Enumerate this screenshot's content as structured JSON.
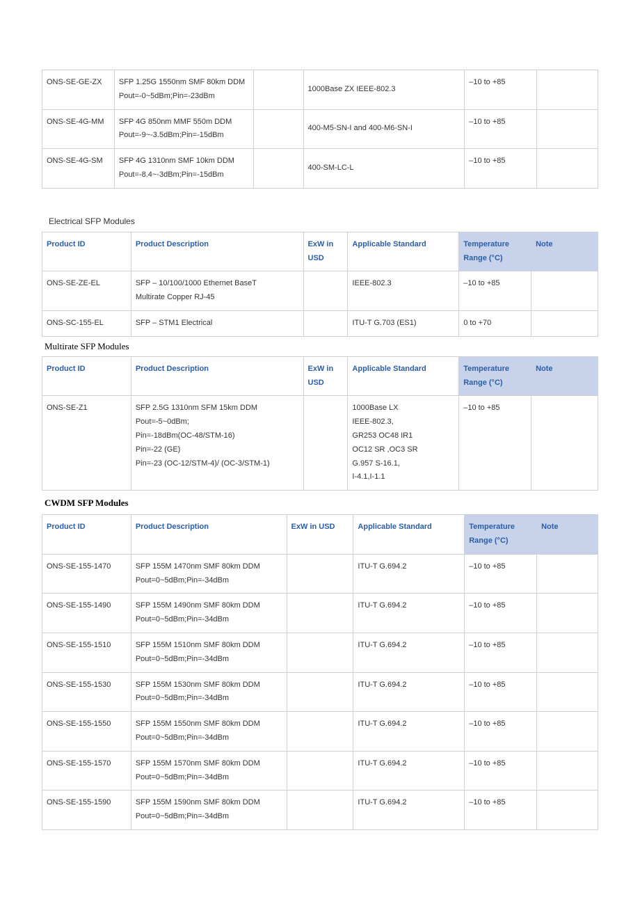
{
  "table1": {
    "rows": [
      {
        "id": "ONS-SE-GE-ZX",
        "desc": [
          "SFP 1.25G 1550nm SMF 80km DDM",
          "Pout=-0~5dBm;Pin=-23dBm"
        ],
        "exw": "",
        "std": "1000Base ZX IEEE-802.3",
        "temp": "–10 to +85",
        "note": ""
      },
      {
        "id": "ONS-SE-4G-MM",
        "desc": [
          "SFP 4G 850nm MMF 550m DDM",
          "Pout=-9~-3.5dBm;Pin=-15dBm"
        ],
        "exw": "",
        "std": "400-M5-SN-I and 400-M6-SN-I",
        "temp": "–10 to +85",
        "note": ""
      },
      {
        "id": "ONS-SE-4G-SM",
        "desc": [
          "SFP 4G 1310nm SMF 10km DDM",
          "Pout=-8.4~-3dBm;Pin=-15dBm"
        ],
        "exw": "",
        "std": "400-SM-LC-L",
        "temp": "–10 to +85",
        "note": ""
      }
    ]
  },
  "section2": {
    "title": "Electrical SFP Modules"
  },
  "table2": {
    "headers": {
      "c1": "Product ID",
      "c2": "Product Description",
      "c3": "ExW in USD",
      "c4": "Applicable Standard",
      "c5": "Temperature Range (°C)",
      "c6": "Note"
    },
    "rows": [
      {
        "id": "ONS-SE-ZE-EL",
        "desc": [
          "SFP – 10/100/1000 Ethernet BaseT",
          "Multirate Copper RJ-45"
        ],
        "exw": "",
        "std": "IEEE-802.3",
        "temp": "–10 to +85",
        "note": ""
      },
      {
        "id": "ONS-SC-155-EL",
        "desc": [
          "SFP – STM1 Electrical"
        ],
        "exw": "",
        "std": "ITU-T G.703 (ES1)",
        "temp": "0 to +70",
        "note": ""
      }
    ]
  },
  "section3": {
    "title": "Multirate SFP Modules"
  },
  "table3": {
    "headers": {
      "c1": "Product ID",
      "c2": "Product Description",
      "c3": "ExW in USD",
      "c4": "Applicable Standard",
      "c5": "Temperature Range (°C)",
      "c6": "Note"
    },
    "rows": [
      {
        "id": "ONS-SE-Z1",
        "desc": [
          "SFP 2.5G 1310nm SFM 15km DDM",
          "Pout=-5~0dBm;",
          "Pin=-18dBm(OC-48/STM-16)",
          "Pin=-22 (GE)",
          "Pin=-23 (OC-12/STM-4)/ (OC-3/STM-1)"
        ],
        "exw": "",
        "std": [
          "1000Base LX",
          "IEEE-802.3,",
          "GR253 OC48 IR1",
          "OC12 SR ,OC3 SR",
          "G.957 S-16.1,",
          "I-4.1,I-1.1"
        ],
        "temp": "–10 to +85",
        "note": ""
      }
    ]
  },
  "section4": {
    "title": "CWDM SFP Modules"
  },
  "table4": {
    "headers": {
      "c1": "Product ID",
      "c2": "Product Description",
      "c3": "ExW in USD",
      "c4": "Applicable Standard",
      "c5": "Temperature Range (°C)",
      "c6": "Note"
    },
    "rows": [
      {
        "id": "ONS-SE-155-1470",
        "desc": [
          "SFP 155M 1470nm SMF 80km DDM",
          "Pout=0~5dBm;Pin=-34dBm"
        ],
        "exw": "",
        "std": "ITU-T G.694.2",
        "temp": "–10 to +85",
        "note": ""
      },
      {
        "id": "ONS-SE-155-1490",
        "desc": [
          "SFP 155M 1490nm SMF 80km DDM",
          "Pout=0~5dBm;Pin=-34dBm"
        ],
        "exw": "",
        "std": "ITU-T G.694.2",
        "temp": "–10 to +85",
        "note": ""
      },
      {
        "id": "ONS-SE-155-1510",
        "desc": [
          "SFP 155M 1510nm SMF 80km DDM",
          "Pout=0~5dBm;Pin=-34dBm"
        ],
        "exw": "",
        "std": "ITU-T G.694.2",
        "temp": "–10 to +85",
        "note": ""
      },
      {
        "id": "ONS-SE-155-1530",
        "desc": [
          "SFP 155M 1530nm SMF 80km DDM",
          "Pout=0~5dBm;Pin=-34dBm"
        ],
        "exw": "",
        "std": "ITU-T G.694.2",
        "temp": "–10 to +85",
        "note": ""
      },
      {
        "id": "ONS-SE-155-1550",
        "desc": [
          "SFP 155M 1550nm SMF 80km DDM",
          "Pout=0~5dBm;Pin=-34dBm"
        ],
        "exw": "",
        "std": "ITU-T G.694.2",
        "temp": "–10 to +85",
        "note": ""
      },
      {
        "id": "ONS-SE-155-1570",
        "desc": [
          "SFP 155M 1570nm SMF 80km DDM",
          "Pout=0~5dBm;Pin=-34dBm"
        ],
        "exw": "",
        "std": "ITU-T G.694.2",
        "temp": "–10 to +85",
        "note": ""
      },
      {
        "id": "ONS-SE-155-1590",
        "desc": [
          "SFP 155M 1590nm SMF 80km DDM",
          "Pout=0~5dBm;Pin=-34dBm"
        ],
        "exw": "",
        "std": "ITU-T G.694.2",
        "temp": "–10 to +85",
        "note": ""
      }
    ]
  }
}
